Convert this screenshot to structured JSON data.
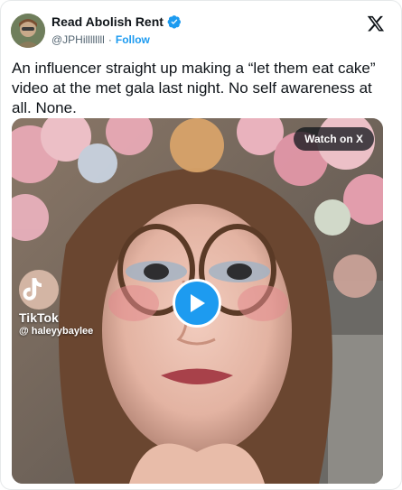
{
  "author": {
    "display_name": "Read Abolish Rent",
    "handle": "@JPHillllllll",
    "separator": "·",
    "follow_label": "Follow",
    "verified_icon": "verified-badge-icon",
    "avatar_icon": "avatar"
  },
  "tweet": {
    "text": "An influencer straight up making a “let them eat cake” video at the met gala last night. No self awareness at all. None."
  },
  "media": {
    "watch_label": "Watch on X",
    "watermark_brand": "TikTok",
    "watermark_user": "@ haleyybaylee",
    "play_icon": "play-icon"
  },
  "colors": {
    "accent": "#1d9bf0",
    "text": "#0f1419",
    "muted": "#536471"
  }
}
